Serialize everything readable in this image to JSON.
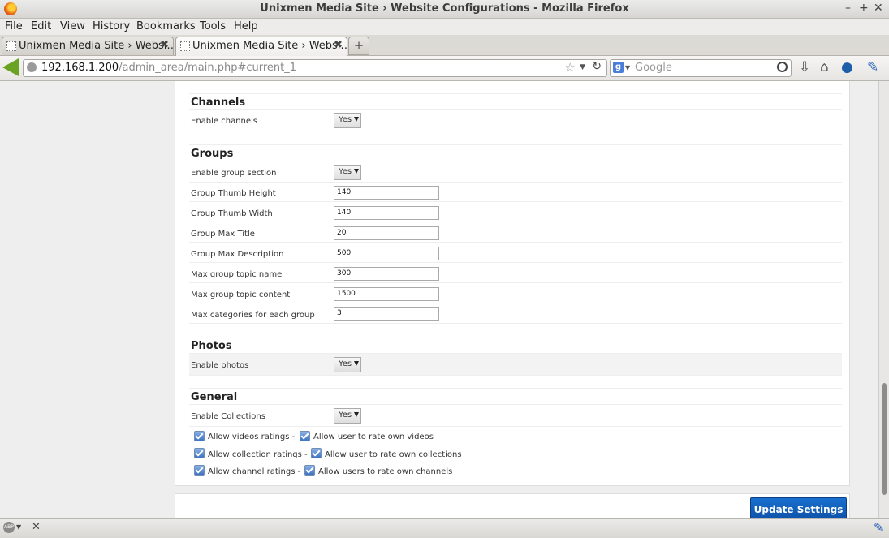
{
  "window": {
    "title": "Unixmen Media Site › Website Configurations - Mozilla Firefox",
    "controls": [
      "–",
      "+",
      "✕"
    ]
  },
  "menu": [
    "File",
    "Edit",
    "View",
    "History",
    "Bookmarks",
    "Tools",
    "Help"
  ],
  "tabs": [
    {
      "label": "Unixmen Media Site › Websi…",
      "close": "✖"
    },
    {
      "label": "Unixmen Media Site › Websi…",
      "close": "✖"
    }
  ],
  "new_tab": "+",
  "url": {
    "host": "192.168.1.200",
    "path": "/admin_area/main.php#current_1"
  },
  "search": {
    "engine_glyph": "g",
    "placeholder": "Google"
  },
  "sections": {
    "channels": {
      "title": "Channels",
      "rows": [
        {
          "label": "Enable channels",
          "value": "Yes"
        }
      ]
    },
    "groups": {
      "title": "Groups",
      "rows": [
        {
          "label": "Enable group section",
          "value": "Yes"
        },
        {
          "label": "Group Thumb Height",
          "value": "140"
        },
        {
          "label": "Group Thumb Width",
          "value": "140"
        },
        {
          "label": "Group Max Title",
          "value": "20"
        },
        {
          "label": "Group Max Description",
          "value": "500"
        },
        {
          "label": "Max group topic name",
          "value": "300"
        },
        {
          "label": "Max group topic content",
          "value": "1500"
        },
        {
          "label": "Max categories for each group",
          "value": "3"
        }
      ]
    },
    "photos": {
      "title": "Photos",
      "rows": [
        {
          "label": "Enable photos",
          "value": "Yes"
        }
      ]
    },
    "general": {
      "title": "General",
      "rows": [
        {
          "label": "Enable Collections",
          "value": "Yes"
        }
      ],
      "checks": [
        {
          "a": "Allow videos ratings -",
          "b": "Allow user to rate own videos"
        },
        {
          "a": "Allow collection ratings -",
          "b": "Allow user to rate own collections"
        },
        {
          "a": "Allow channel ratings -",
          "b": "Allow users to rate own channels"
        }
      ]
    }
  },
  "update_button": "Update Settings",
  "status": {
    "abp": "ABP",
    "close": "✕"
  },
  "colors": {
    "accent": "#0c4fa6",
    "checkbox": "#3f74c1",
    "back_arrow": "#6aa223"
  }
}
